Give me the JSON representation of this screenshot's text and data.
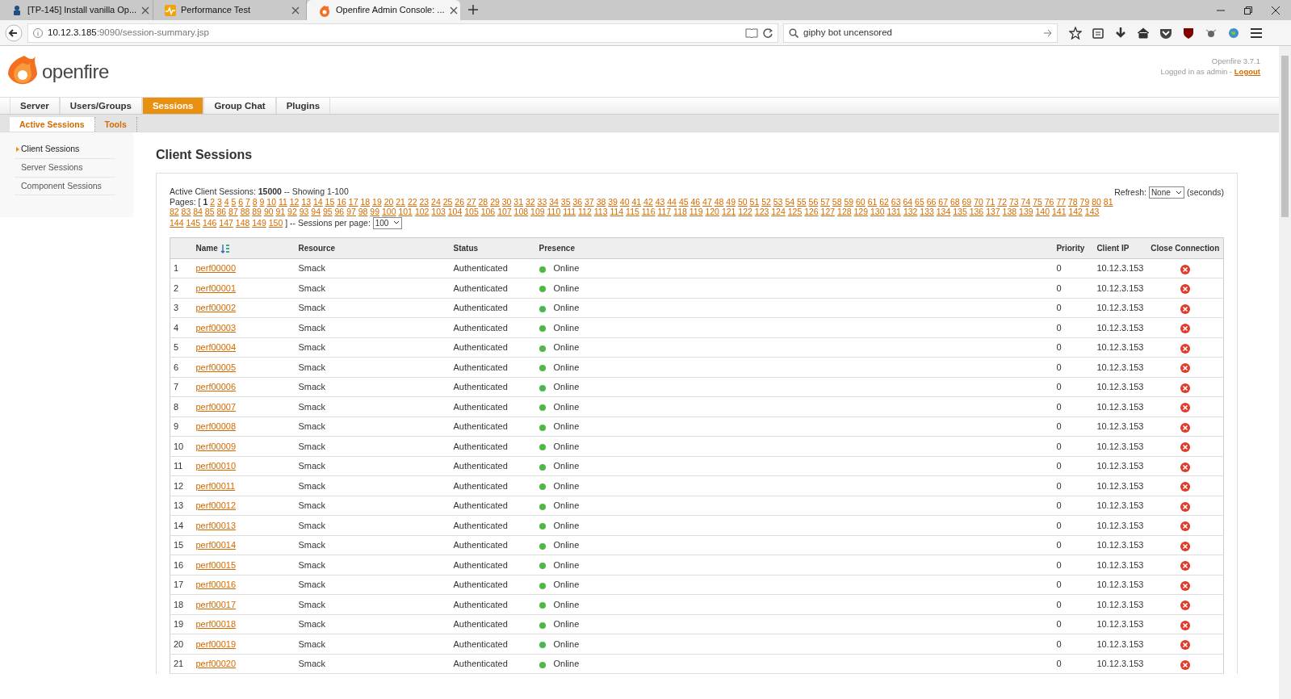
{
  "browser": {
    "tabs": [
      {
        "label": "[TP-145] Install vanilla Op...",
        "selected": false
      },
      {
        "label": "Performance Test",
        "selected": false
      },
      {
        "label": "Openfire Admin Console: ...",
        "selected": true
      }
    ],
    "address": {
      "host": "10.12.3.185",
      "rest": ":9090/session-summary.jsp"
    },
    "search": {
      "value": "giphy bot uncensored"
    }
  },
  "header": {
    "logo_text": "openfire",
    "version": "Openfire 3.7.1",
    "login_text": "Logged in as admin - ",
    "logout": "Logout"
  },
  "nav": [
    {
      "label": "Server",
      "selected": false
    },
    {
      "label": "Users/Groups",
      "selected": false
    },
    {
      "label": "Sessions",
      "selected": true
    },
    {
      "label": "Group Chat",
      "selected": false
    },
    {
      "label": "Plugins",
      "selected": false
    }
  ],
  "subnav": [
    {
      "label": "Active Sessions",
      "selected": true
    },
    {
      "label": "Tools",
      "selected": false
    }
  ],
  "sidebar": {
    "items": [
      {
        "label": "Client Sessions",
        "selected": true
      },
      {
        "label": "Server Sessions",
        "selected": false
      },
      {
        "label": "Component Sessions",
        "selected": false
      }
    ]
  },
  "page_title": "Client Sessions",
  "summary": "Active Client Sessions: **15000** -- Showing 1-100",
  "pages_label": "Pages: [",
  "pages": [
    {
      "label": "1",
      "selected": true
    },
    {
      "label": "2",
      "selected": false
    },
    {
      "label": "3",
      "selected": false
    },
    {
      "label": "4",
      "selected": false
    },
    {
      "label": "5",
      "selected": false
    },
    {
      "label": "6",
      "selected": false
    },
    {
      "label": "7",
      "selected": false
    },
    {
      "label": "8",
      "selected": false
    },
    {
      "label": "9",
      "selected": false
    },
    {
      "label": "10",
      "selected": false
    },
    {
      "label": "11",
      "selected": false
    },
    {
      "label": "12",
      "selected": false
    },
    {
      "label": "13",
      "selected": false
    },
    {
      "label": "14",
      "selected": false
    },
    {
      "label": "15",
      "selected": false
    },
    {
      "label": "16",
      "selected": false
    },
    {
      "label": "17",
      "selected": false
    },
    {
      "label": "18",
      "selected": false
    },
    {
      "label": "19",
      "selected": false
    },
    {
      "label": "20",
      "selected": false
    },
    {
      "label": "21",
      "selected": false
    },
    {
      "label": "22",
      "selected": false
    },
    {
      "label": "23",
      "selected": false
    },
    {
      "label": "24",
      "selected": false
    },
    {
      "label": "25",
      "selected": false
    },
    {
      "label": "26",
      "selected": false
    },
    {
      "label": "27",
      "selected": false
    },
    {
      "label": "28",
      "selected": false
    },
    {
      "label": "29",
      "selected": false
    },
    {
      "label": "30",
      "selected": false
    },
    {
      "label": "31",
      "selected": false
    },
    {
      "label": "32",
      "selected": false
    },
    {
      "label": "33",
      "selected": false
    },
    {
      "label": "34",
      "selected": false
    },
    {
      "label": "35",
      "selected": false
    },
    {
      "label": "36",
      "selected": false
    },
    {
      "label": "37",
      "selected": false
    },
    {
      "label": "38",
      "selected": false
    },
    {
      "label": "39",
      "selected": false
    },
    {
      "label": "40",
      "selected": false
    },
    {
      "label": "41",
      "selected": false
    },
    {
      "label": "42",
      "selected": false
    },
    {
      "label": "43",
      "selected": false
    },
    {
      "label": "44",
      "selected": false
    },
    {
      "label": "45",
      "selected": false
    },
    {
      "label": "46",
      "selected": false
    },
    {
      "label": "47",
      "selected": false
    },
    {
      "label": "48",
      "selected": false
    },
    {
      "label": "49",
      "selected": false
    },
    {
      "label": "50",
      "selected": false
    },
    {
      "label": "51",
      "selected": false
    },
    {
      "label": "52",
      "selected": false
    },
    {
      "label": "53",
      "selected": false
    },
    {
      "label": "54",
      "selected": false
    },
    {
      "label": "55",
      "selected": false
    },
    {
      "label": "56",
      "selected": false
    },
    {
      "label": "57",
      "selected": false
    },
    {
      "label": "58",
      "selected": false
    },
    {
      "label": "59",
      "selected": false
    },
    {
      "label": "60",
      "selected": false
    },
    {
      "label": "61",
      "selected": false
    },
    {
      "label": "62",
      "selected": false
    },
    {
      "label": "63",
      "selected": false
    },
    {
      "label": "64",
      "selected": false
    },
    {
      "label": "65",
      "selected": false
    },
    {
      "label": "66",
      "selected": false
    },
    {
      "label": "67",
      "selected": false
    },
    {
      "label": "68",
      "selected": false
    },
    {
      "label": "69",
      "selected": false
    },
    {
      "label": "70",
      "selected": false
    },
    {
      "label": "71",
      "selected": false
    },
    {
      "label": "72",
      "selected": false
    },
    {
      "label": "73",
      "selected": false
    },
    {
      "label": "74",
      "selected": false
    },
    {
      "label": "75",
      "selected": false
    },
    {
      "label": "76",
      "selected": false
    },
    {
      "label": "77",
      "selected": false
    },
    {
      "label": "78",
      "selected": false
    },
    {
      "label": "79",
      "selected": false
    },
    {
      "label": "80",
      "selected": false
    },
    {
      "label": "81",
      "selected": false
    },
    {
      "label": "82",
      "selected": false
    },
    {
      "label": "83",
      "selected": false
    },
    {
      "label": "84",
      "selected": false
    },
    {
      "label": "85",
      "selected": false
    },
    {
      "label": "86",
      "selected": false
    },
    {
      "label": "87",
      "selected": false
    },
    {
      "label": "88",
      "selected": false
    },
    {
      "label": "89",
      "selected": false
    },
    {
      "label": "90",
      "selected": false
    },
    {
      "label": "91",
      "selected": false
    },
    {
      "label": "92",
      "selected": false
    },
    {
      "label": "93",
      "selected": false
    },
    {
      "label": "94",
      "selected": false
    },
    {
      "label": "95",
      "selected": false
    },
    {
      "label": "96",
      "selected": false
    },
    {
      "label": "97",
      "selected": false
    },
    {
      "label": "98",
      "selected": false
    },
    {
      "label": "99",
      "selected": false
    },
    {
      "label": "100",
      "selected": false
    },
    {
      "label": "101",
      "selected": false
    },
    {
      "label": "102",
      "selected": false
    },
    {
      "label": "103",
      "selected": false
    },
    {
      "label": "104",
      "selected": false
    },
    {
      "label": "105",
      "selected": false
    },
    {
      "label": "106",
      "selected": false
    },
    {
      "label": "107",
      "selected": false
    },
    {
      "label": "108",
      "selected": false
    },
    {
      "label": "109",
      "selected": false
    },
    {
      "label": "110",
      "selected": false
    },
    {
      "label": "111",
      "selected": false
    },
    {
      "label": "112",
      "selected": false
    },
    {
      "label": "113",
      "selected": false
    },
    {
      "label": "114",
      "selected": false
    },
    {
      "label": "115",
      "selected": false
    },
    {
      "label": "116",
      "selected": false
    },
    {
      "label": "117",
      "selected": false
    },
    {
      "label": "118",
      "selected": false
    },
    {
      "label": "119",
      "selected": false
    },
    {
      "label": "120",
      "selected": false
    },
    {
      "label": "121",
      "selected": false
    },
    {
      "label": "122",
      "selected": false
    },
    {
      "label": "123",
      "selected": false
    },
    {
      "label": "124",
      "selected": false
    },
    {
      "label": "125",
      "selected": false
    },
    {
      "label": "126",
      "selected": false
    },
    {
      "label": "127",
      "selected": false
    },
    {
      "label": "128",
      "selected": false
    },
    {
      "label": "129",
      "selected": false
    },
    {
      "label": "130",
      "selected": false
    },
    {
      "label": "131",
      "selected": false
    },
    {
      "label": "132",
      "selected": false
    },
    {
      "label": "133",
      "selected": false
    },
    {
      "label": "134",
      "selected": false
    },
    {
      "label": "135",
      "selected": false
    },
    {
      "label": "136",
      "selected": false
    },
    {
      "label": "137",
      "selected": false
    },
    {
      "label": "138",
      "selected": false
    },
    {
      "label": "139",
      "selected": false
    },
    {
      "label": "140",
      "selected": false
    },
    {
      "label": "141",
      "selected": false
    },
    {
      "label": "142",
      "selected": false
    },
    {
      "label": "143",
      "selected": false
    },
    {
      "label": "144",
      "selected": false
    },
    {
      "label": "145",
      "selected": false
    },
    {
      "label": "146",
      "selected": false
    },
    {
      "label": "147",
      "selected": false
    },
    {
      "label": "148",
      "selected": false
    },
    {
      "label": "149",
      "selected": false
    },
    {
      "label": "150",
      "selected": false
    }
  ],
  "pages_end": "] -- Sessions per page:",
  "per_page": "100",
  "refresh": {
    "label": "Refresh:",
    "value": "None",
    "unit": "(seconds)"
  },
  "table": {
    "columns": [
      "Name",
      "Resource",
      "Status",
      "Presence",
      "Priority",
      "Client IP",
      "Close Connection"
    ],
    "rows": [
      {
        "n": "1",
        "name": "perf00000",
        "resource": "Smack",
        "status": "Authenticated",
        "presence": "Online",
        "priority": "0",
        "ip": "10.12.3.153"
      },
      {
        "n": "2",
        "name": "perf00001",
        "resource": "Smack",
        "status": "Authenticated",
        "presence": "Online",
        "priority": "0",
        "ip": "10.12.3.153"
      },
      {
        "n": "3",
        "name": "perf00002",
        "resource": "Smack",
        "status": "Authenticated",
        "presence": "Online",
        "priority": "0",
        "ip": "10.12.3.153"
      },
      {
        "n": "4",
        "name": "perf00003",
        "resource": "Smack",
        "status": "Authenticated",
        "presence": "Online",
        "priority": "0",
        "ip": "10.12.3.153"
      },
      {
        "n": "5",
        "name": "perf00004",
        "resource": "Smack",
        "status": "Authenticated",
        "presence": "Online",
        "priority": "0",
        "ip": "10.12.3.153"
      },
      {
        "n": "6",
        "name": "perf00005",
        "resource": "Smack",
        "status": "Authenticated",
        "presence": "Online",
        "priority": "0",
        "ip": "10.12.3.153"
      },
      {
        "n": "7",
        "name": "perf00006",
        "resource": "Smack",
        "status": "Authenticated",
        "presence": "Online",
        "priority": "0",
        "ip": "10.12.3.153"
      },
      {
        "n": "8",
        "name": "perf00007",
        "resource": "Smack",
        "status": "Authenticated",
        "presence": "Online",
        "priority": "0",
        "ip": "10.12.3.153"
      },
      {
        "n": "9",
        "name": "perf00008",
        "resource": "Smack",
        "status": "Authenticated",
        "presence": "Online",
        "priority": "0",
        "ip": "10.12.3.153"
      },
      {
        "n": "10",
        "name": "perf00009",
        "resource": "Smack",
        "status": "Authenticated",
        "presence": "Online",
        "priority": "0",
        "ip": "10.12.3.153"
      },
      {
        "n": "11",
        "name": "perf00010",
        "resource": "Smack",
        "status": "Authenticated",
        "presence": "Online",
        "priority": "0",
        "ip": "10.12.3.153"
      },
      {
        "n": "12",
        "name": "perf00011",
        "resource": "Smack",
        "status": "Authenticated",
        "presence": "Online",
        "priority": "0",
        "ip": "10.12.3.153"
      },
      {
        "n": "13",
        "name": "perf00012",
        "resource": "Smack",
        "status": "Authenticated",
        "presence": "Online",
        "priority": "0",
        "ip": "10.12.3.153"
      },
      {
        "n": "14",
        "name": "perf00013",
        "resource": "Smack",
        "status": "Authenticated",
        "presence": "Online",
        "priority": "0",
        "ip": "10.12.3.153"
      },
      {
        "n": "15",
        "name": "perf00014",
        "resource": "Smack",
        "status": "Authenticated",
        "presence": "Online",
        "priority": "0",
        "ip": "10.12.3.153"
      },
      {
        "n": "16",
        "name": "perf00015",
        "resource": "Smack",
        "status": "Authenticated",
        "presence": "Online",
        "priority": "0",
        "ip": "10.12.3.153"
      },
      {
        "n": "17",
        "name": "perf00016",
        "resource": "Smack",
        "status": "Authenticated",
        "presence": "Online",
        "priority": "0",
        "ip": "10.12.3.153"
      },
      {
        "n": "18",
        "name": "perf00017",
        "resource": "Smack",
        "status": "Authenticated",
        "presence": "Online",
        "priority": "0",
        "ip": "10.12.3.153"
      },
      {
        "n": "19",
        "name": "perf00018",
        "resource": "Smack",
        "status": "Authenticated",
        "presence": "Online",
        "priority": "0",
        "ip": "10.12.3.153"
      },
      {
        "n": "20",
        "name": "perf00019",
        "resource": "Smack",
        "status": "Authenticated",
        "presence": "Online",
        "priority": "0",
        "ip": "10.12.3.153"
      },
      {
        "n": "21",
        "name": "perf00020",
        "resource": "Smack",
        "status": "Authenticated",
        "presence": "Online",
        "priority": "0",
        "ip": "10.12.3.153"
      }
    ]
  }
}
